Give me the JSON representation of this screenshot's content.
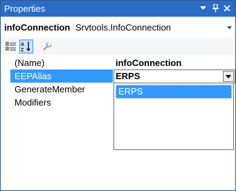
{
  "window": {
    "title": "Properties",
    "buttons": {
      "dropdown": "▾",
      "pin": "pin",
      "close": "×"
    }
  },
  "object_selector": {
    "name": "infoConnection",
    "type": "Srvtools.InfoConnection"
  },
  "toolbar": {
    "items": [
      "categorized-view",
      "alphabetical-view",
      "property-pages"
    ],
    "active": "alphabetical-view"
  },
  "properties": [
    {
      "name": "(Name)",
      "value": "infoConnection",
      "value_bold": true
    },
    {
      "name": "EEPAlias",
      "value": "ERPS",
      "selected": true,
      "editing": true
    },
    {
      "name": "GenerateMember",
      "value": ""
    },
    {
      "name": "Modifiers",
      "value": ""
    }
  ],
  "dropdown": {
    "options": [
      "ERPS"
    ],
    "highlighted": "ERPS"
  },
  "colors": {
    "titlebar": "#2b6cc4",
    "selection": "#3399ff",
    "toolbar_bg": "#f5f6f8"
  }
}
